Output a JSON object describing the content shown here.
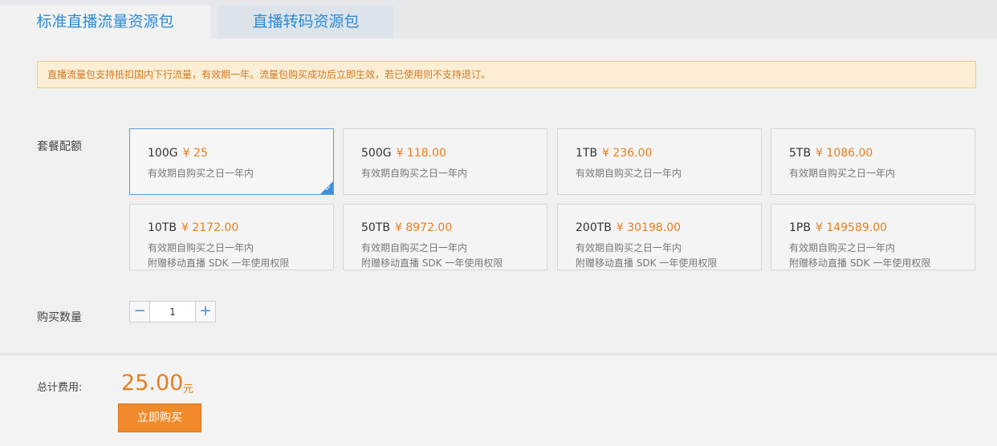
{
  "tabs": [
    {
      "label": "标准直播流量资源包",
      "active": true
    },
    {
      "label": "直播转码资源包",
      "active": false
    }
  ],
  "notice": "直播流量包支持抵扣国内下行流量，有效期一年。流量包购买成功后立即生效，若已使用则不支持退订。",
  "package_label": "套餐配额",
  "packages": [
    {
      "size": "100G",
      "price": "¥ 25",
      "validity": "有效期自购买之日一年内",
      "extra": "",
      "selected": true
    },
    {
      "size": "500G",
      "price": "¥ 118.00",
      "validity": "有效期自购买之日一年内",
      "extra": "",
      "selected": false
    },
    {
      "size": "1TB",
      "price": "¥ 236.00",
      "validity": "有效期自购买之日一年内",
      "extra": "",
      "selected": false
    },
    {
      "size": "5TB",
      "price": "¥ 1086.00",
      "validity": "有效期自购买之日一年内",
      "extra": "",
      "selected": false
    },
    {
      "size": "10TB",
      "price": "¥ 2172.00",
      "validity": "有效期自购买之日一年内",
      "extra": "附赠移动直播 SDK 一年使用权限",
      "selected": false
    },
    {
      "size": "50TB",
      "price": "¥ 8972.00",
      "validity": "有效期自购买之日一年内",
      "extra": "附赠移动直播 SDK 一年使用权限",
      "selected": false
    },
    {
      "size": "200TB",
      "price": "¥ 30198.00",
      "validity": "有效期自购买之日一年内",
      "extra": "附赠移动直播 SDK 一年使用权限",
      "selected": false
    },
    {
      "size": "1PB",
      "price": "¥ 149589.00",
      "validity": "有效期自购买之日一年内",
      "extra": "附赠移动直播 SDK 一年使用权限",
      "selected": false
    }
  ],
  "quantity": {
    "label": "购买数量",
    "value": "1",
    "minus": "−",
    "plus": "+"
  },
  "total": {
    "label": "总计费用:",
    "amount": "25.00",
    "unit": "元"
  },
  "buy_button": "立即购买",
  "colors": {
    "accent": "#2a8bd6",
    "price": "#e87e1c",
    "button": "#f08a2a"
  },
  "icons": {
    "selected_corner": "check-icon"
  }
}
